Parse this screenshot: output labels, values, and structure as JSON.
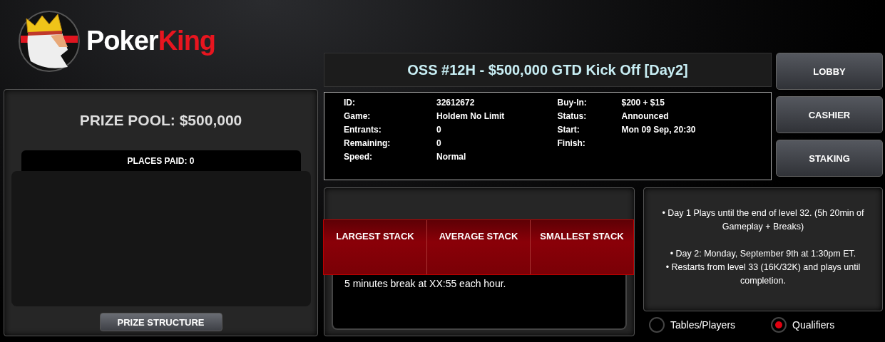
{
  "brand": {
    "name": "Poker",
    "accent": "King"
  },
  "prize_panel": {
    "title": "PRIZE POOL: $500,000",
    "places_paid": "PLACES PAID: 0",
    "button": "PRIZE STRUCTURE"
  },
  "tournament_title": "OSS #12H - $500,000 GTD Kick Off [Day2]",
  "details_left": [
    {
      "label": "ID:",
      "value": "32612672"
    },
    {
      "label": "Game:",
      "value": "Holdem No Limit"
    },
    {
      "label": "Entrants:",
      "value": "0"
    },
    {
      "label": "Remaining:",
      "value": "0"
    },
    {
      "label": "Speed:",
      "value": "Normal"
    }
  ],
  "details_right": [
    {
      "label": "Buy-In:",
      "value": "$200 + $15"
    },
    {
      "label": "Status:",
      "value": "Announced"
    },
    {
      "label": "Start:",
      "value": "Mon 09 Sep, 20:30"
    },
    {
      "label": "Finish:"
    }
  ],
  "nav_buttons": [
    "LOBBY",
    "CASHIER",
    "STAKING"
  ],
  "stack_columns": [
    "LARGEST STACK",
    "AVERAGE STACK",
    "SMALLEST STACK"
  ],
  "break_note": "5 minutes break at XX:55 each hour.",
  "notes": [
    [
      "• Day 1 Plays until the end of level 32. (5h 20min of Gameplay + Breaks)"
    ],
    [
      "• Day 2: Monday, September 9th at 1:30pm ET.",
      "• Restarts from level 33 (16K/32K) and plays until completion."
    ]
  ],
  "view_options": [
    {
      "label": "Tables/Players",
      "selected": false
    },
    {
      "label": "Qualifiers",
      "selected": true
    }
  ]
}
